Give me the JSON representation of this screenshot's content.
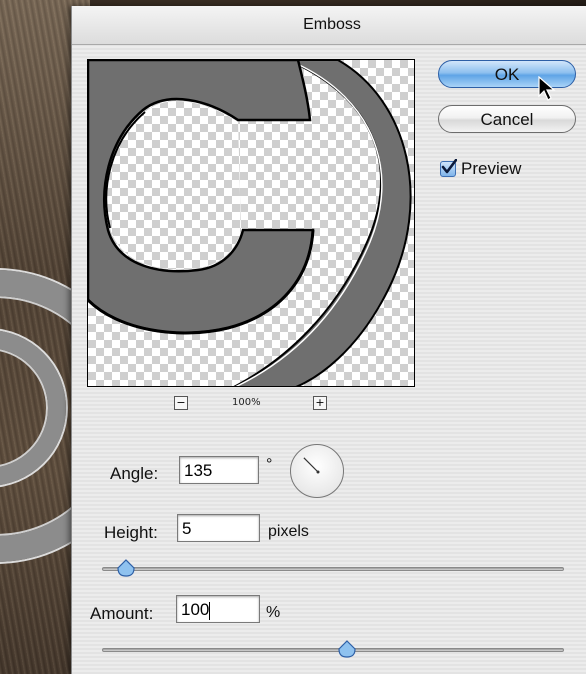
{
  "dialog": {
    "title": "Emboss"
  },
  "buttons": {
    "ok_label": "OK",
    "cancel_label": "Cancel"
  },
  "preview_toggle": {
    "label": "Preview",
    "checked": true
  },
  "zoom": {
    "minus": "−",
    "plus": "+",
    "level": "100%"
  },
  "angle": {
    "label": "Angle:",
    "value": "135",
    "unit": "°",
    "degrees": 135
  },
  "height": {
    "label": "Height:",
    "value": "5",
    "unit": "pixels",
    "slider_fraction": 0.03
  },
  "amount": {
    "label": "Amount:",
    "value": "100",
    "unit": "%",
    "slider_fraction": 0.53
  },
  "colors": {
    "accent": "#5fa4e6",
    "emboss_gray": "#6f6f6f"
  },
  "icons": {
    "checkmark": "checkmark-icon",
    "cursor": "mouse-pointer-icon"
  }
}
